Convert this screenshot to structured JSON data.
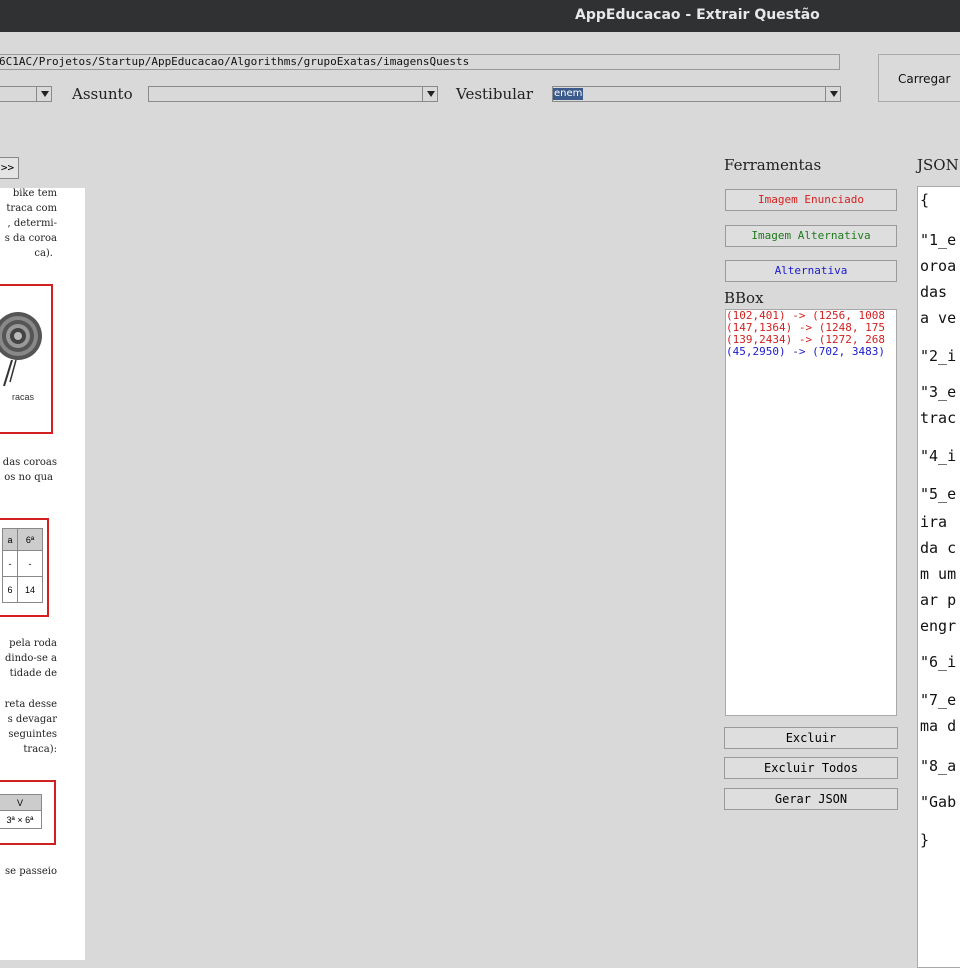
{
  "window": {
    "title": "AppEducacao - Extrair Questão"
  },
  "toolbar": {
    "path_value": "6C1AC/Projetos/Startup/AppEducacao/Algorithms/grupoExatas/imagensQuests",
    "load_button": "Carregar",
    "assunto_label": "Assunto",
    "assunto_value": "",
    "vestibular_label": "Vestibular",
    "vestibular_value": "enem",
    "first_combo_value": ""
  },
  "nav": {
    "next_label": ">>"
  },
  "document": {
    "para1": [
      "bike tem",
      "traca com",
      ", determi-",
      "s da coroa",
      "ca)."
    ],
    "image1_caption": "racas",
    "para2": [
      "das coroas",
      "os no qua"
    ],
    "table1": {
      "header": [
        "a",
        "6ª"
      ],
      "row1": [
        "-",
        "-"
      ],
      "row2": [
        "6",
        "14"
      ]
    },
    "para3": [
      "pela roda",
      "dindo-se a",
      "tidade de"
    ],
    "para4": [
      "reta desse",
      "s devagar",
      "seguintes",
      "traca):"
    ],
    "table2": {
      "header": "V",
      "row": "3ª × 6ª"
    },
    "para5": [
      "se passeio"
    ]
  },
  "tools": {
    "heading": "Ferramentas",
    "btn_image_statement": "Imagem Enunciado",
    "btn_image_alternative": "Imagem Alternativa",
    "btn_alternative": "Alternativa",
    "bbox_heading": "BBox",
    "bbox_items": [
      {
        "text": "(102,401) -> (1256, 1008",
        "color": "#d21f1f"
      },
      {
        "text": "(147,1364) -> (1248, 175",
        "color": "#d21f1f"
      },
      {
        "text": "(139,2434) -> (1272, 268",
        "color": "#d21f1f"
      },
      {
        "text": "(45,2950) -> (702, 3483)",
        "color": "#1a1acd"
      }
    ],
    "btn_delete": "Excluir",
    "btn_delete_all": "Excluir Todos",
    "btn_generate_json": "Gerar JSON"
  },
  "json_panel": {
    "heading": "JSON",
    "lines": [
      "{",
      "\"1_e",
      "oroa",
      "das",
      "a ve",
      "\"2_i",
      "\"3_e",
      "trac",
      "\"4_i",
      "\"5_e",
      "ira",
      "da c",
      "m um",
      "ar p",
      "engr",
      "\"6_i",
      "\"7_e",
      "ma d",
      "\"8_a",
      "\"Gab",
      "}"
    ]
  },
  "colors": {
    "red": "#d21f1f",
    "green": "#1e7a1e",
    "blue": "#1a1acd",
    "titlebar": "#2f3133",
    "window_bg": "#d9d9d9"
  }
}
